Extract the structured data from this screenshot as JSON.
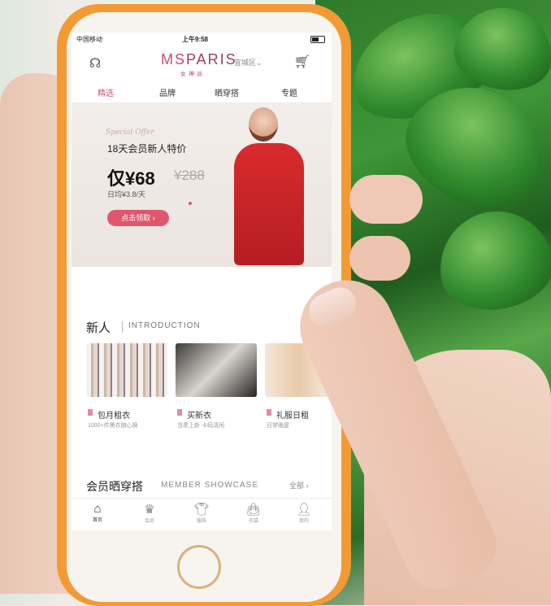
{
  "status": {
    "carrier": "中国移动",
    "time": "上午9:58"
  },
  "header": {
    "logo": "MSPARIS",
    "logo_sub": "女神派",
    "city": "宜城区",
    "left_icon": "headset-icon",
    "right_icon": "cart-icon"
  },
  "tabs": [
    {
      "label": "精选",
      "active": true
    },
    {
      "label": "品牌",
      "active": false
    },
    {
      "label": "晒穿搭",
      "active": false
    },
    {
      "label": "专题",
      "active": false
    }
  ],
  "banner": {
    "special": "Special Offer",
    "title": "18天会员新人特价",
    "price": "仅¥68",
    "old_price": "¥288",
    "per_day": "日均¥3.8/天",
    "cta": "点击领取 ›"
  },
  "new_section": {
    "title": "新人",
    "subtitle": "INTRODUCTION",
    "cards": [
      {
        "label": "包月租衣",
        "desc": "1000+件美衣随心换"
      },
      {
        "label": "买新衣",
        "desc": "当季上新  卡码清闲"
      },
      {
        "label": "礼服日租",
        "desc": "日常晚宴"
      }
    ]
  },
  "showcase": {
    "title": "会员晒穿搭",
    "subtitle": "MEMBER SHOWCASE",
    "all": "全部 ›"
  },
  "bottom_nav": [
    {
      "label": "首页",
      "icon": "home-icon",
      "active": true
    },
    {
      "label": "会员",
      "icon": "crown-icon",
      "active": false
    },
    {
      "label": "服饰",
      "icon": "shirt-icon",
      "active": false
    },
    {
      "label": "衣袋",
      "icon": "bag-icon",
      "active": false
    },
    {
      "label": "我的",
      "icon": "user-icon",
      "active": false
    }
  ],
  "colors": {
    "accent": "#e0566f",
    "phone_case": "#f39a34",
    "brand": "#c64a73"
  }
}
